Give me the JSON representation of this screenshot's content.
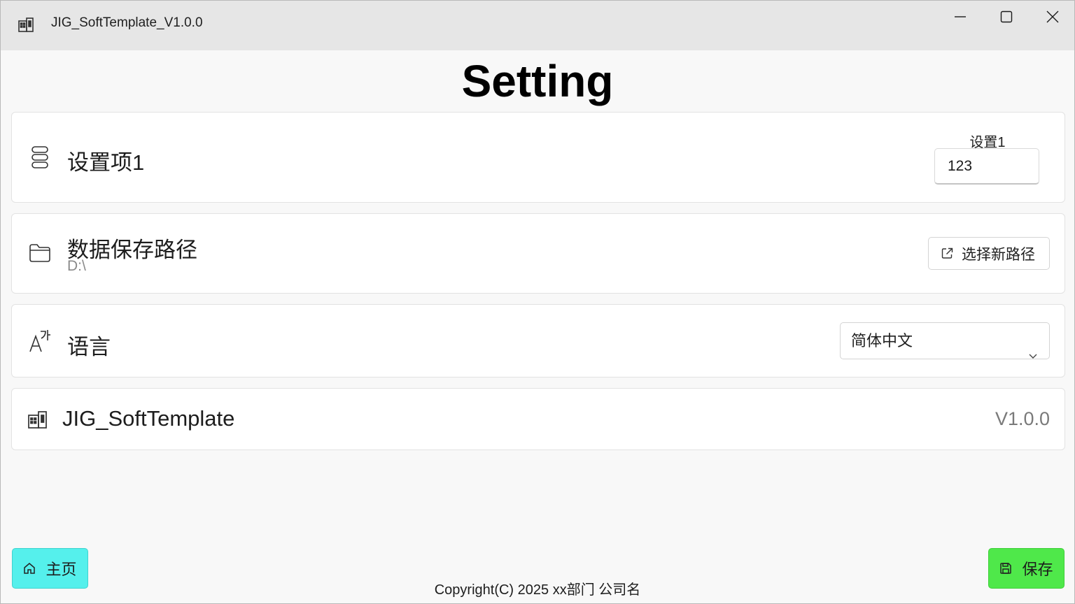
{
  "window": {
    "title": "JIG_SoftTemplate_V1.0.0",
    "app_icon": "building-icon",
    "controls": [
      "minimize-icon",
      "maximize-icon",
      "close-icon"
    ]
  },
  "page": {
    "title": "Setting"
  },
  "settings": {
    "item1": {
      "icon": "storage-icon",
      "label": "设置项1",
      "caption": "设置1",
      "value": "123"
    },
    "path": {
      "icon": "folder-icon",
      "label": "数据保存路径",
      "value": "D:\\",
      "button_icon": "open-external-icon",
      "button_label": "选择新路径"
    },
    "language": {
      "icon": "language-icon",
      "label": "语言",
      "selected": "简体中文"
    },
    "about": {
      "icon": "building-icon",
      "label": "JIG_SoftTemplate",
      "version": "V1.0.0"
    }
  },
  "footer": {
    "home_icon": "home-icon",
    "home_label": "主页",
    "save_icon": "save-icon",
    "save_label": "保存",
    "copyright": "Copyright(C) 2025 xx部门 公司名"
  },
  "colors": {
    "home_button": "#55f0ec",
    "save_button": "#4fe84a",
    "card_bg": "#ffffff",
    "page_bg": "#f8f8f8"
  }
}
